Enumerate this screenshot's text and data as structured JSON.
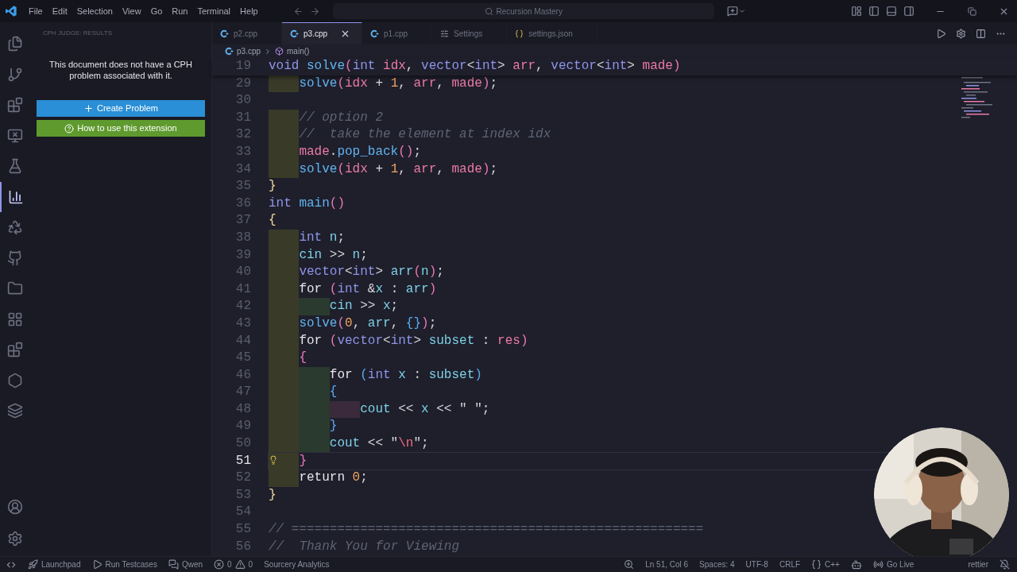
{
  "title_bar": {
    "menu": [
      "File",
      "Edit",
      "Selection",
      "View",
      "Go",
      "Run",
      "Terminal",
      "Help"
    ],
    "search": "Recursion Mastery"
  },
  "sidebar": {
    "title": "CPH JUDGE: RESULTS",
    "message": "This document does not have a CPH problem associated with it.",
    "buttons": [
      {
        "label": "Create Problem",
        "kind": "create"
      },
      {
        "label": "How to use this extension",
        "kind": "help"
      }
    ]
  },
  "tabs": [
    {
      "label": "p2.cpp",
      "kind": "cpp",
      "selected": false
    },
    {
      "label": "p3.cpp",
      "kind": "cpp",
      "selected": true
    },
    {
      "label": "p1.cpp",
      "kind": "cpp",
      "selected": false
    },
    {
      "label": "Settings",
      "kind": "settings",
      "selected": false
    },
    {
      "label": "settings.json",
      "kind": "json",
      "selected": false
    }
  ],
  "breadcrumb": [
    "p3.cpp",
    "main()"
  ],
  "editor": {
    "sticky": {
      "number": "19",
      "tokens": [
        {
          "kind": "kw",
          "text": "void "
        },
        {
          "kind": "fn",
          "text": "solve"
        },
        {
          "kind": "b1",
          "text": "("
        },
        {
          "kind": "kw",
          "text": "int "
        },
        {
          "kind": "param",
          "text": "idx"
        },
        {
          "kind": "p",
          "text": ", "
        },
        {
          "kind": "kw",
          "text": "vector"
        },
        {
          "kind": "p",
          "text": "<"
        },
        {
          "kind": "kw",
          "text": "int"
        },
        {
          "kind": "p",
          "text": "> "
        },
        {
          "kind": "param",
          "text": "arr"
        },
        {
          "kind": "p",
          "text": ", "
        },
        {
          "kind": "kw",
          "text": "vector"
        },
        {
          "kind": "p",
          "text": "<"
        },
        {
          "kind": "kw",
          "text": "int"
        },
        {
          "kind": "p",
          "text": "> "
        },
        {
          "kind": "param",
          "text": "made"
        },
        {
          "kind": "b1",
          "text": ")"
        }
      ]
    },
    "lines": [
      {
        "number": "29",
        "current": false,
        "lightbulb": false,
        "indent_guides": [
          {
            "color": "#393a28"
          }
        ],
        "tokens": [
          {
            "kind": "fn",
            "text": "solve"
          },
          {
            "kind": "b1",
            "text": "("
          },
          {
            "kind": "param",
            "text": "idx"
          },
          {
            "kind": "p",
            "text": " + "
          },
          {
            "kind": "num",
            "text": "1"
          },
          {
            "kind": "p",
            "text": ", "
          },
          {
            "kind": "param",
            "text": "arr"
          },
          {
            "kind": "p",
            "text": ", "
          },
          {
            "kind": "param",
            "text": "made"
          },
          {
            "kind": "b1",
            "text": ")"
          },
          {
            "kind": "p",
            "text": ";"
          }
        ]
      },
      {
        "number": "30",
        "current": false,
        "lightbulb": false
      },
      {
        "number": "31",
        "current": false,
        "lightbulb": false,
        "indent_guides": [
          {
            "color": "#393a28"
          }
        ],
        "tokens": [
          {
            "kind": "cm",
            "text": "// option 2"
          }
        ]
      },
      {
        "number": "32",
        "current": false,
        "lightbulb": false,
        "indent_guides": [
          {
            "color": "#393a28"
          }
        ],
        "tokens": [
          {
            "kind": "cm",
            "text": "//  take the element at index idx"
          }
        ]
      },
      {
        "number": "33",
        "current": false,
        "lightbulb": false,
        "indent_guides": [
          {
            "color": "#393a28"
          }
        ],
        "tokens": [
          {
            "kind": "param",
            "text": "made"
          },
          {
            "kind": "p",
            "text": "."
          },
          {
            "kind": "fn",
            "text": "pop_back"
          },
          {
            "kind": "b1",
            "text": "()"
          },
          {
            "kind": "p",
            "text": ";"
          }
        ]
      },
      {
        "number": "34",
        "current": false,
        "lightbulb": false,
        "indent_guides": [
          {
            "color": "#393a28"
          }
        ],
        "tokens": [
          {
            "kind": "fn",
            "text": "solve"
          },
          {
            "kind": "b1",
            "text": "("
          },
          {
            "kind": "param",
            "text": "idx"
          },
          {
            "kind": "p",
            "text": " + "
          },
          {
            "kind": "num",
            "text": "1"
          },
          {
            "kind": "p",
            "text": ", "
          },
          {
            "kind": "param",
            "text": "arr"
          },
          {
            "kind": "p",
            "text": ", "
          },
          {
            "kind": "param",
            "text": "made"
          },
          {
            "kind": "b1",
            "text": ")"
          },
          {
            "kind": "p",
            "text": ";"
          }
        ]
      },
      {
        "number": "35",
        "current": false,
        "lightbulb": false,
        "tokens": [
          {
            "kind": "b0",
            "text": "}"
          }
        ]
      },
      {
        "number": "36",
        "current": false,
        "lightbulb": false,
        "tokens": [
          {
            "kind": "kw",
            "text": "int "
          },
          {
            "kind": "fn",
            "text": "main"
          },
          {
            "kind": "b1",
            "text": "()"
          }
        ]
      },
      {
        "number": "37",
        "current": false,
        "lightbulb": false,
        "tokens": [
          {
            "kind": "b0",
            "text": "{"
          }
        ]
      },
      {
        "number": "38",
        "current": false,
        "lightbulb": false,
        "indent_guides": [
          {
            "color": "#393a28"
          }
        ],
        "tokens": [
          {
            "kind": "kw",
            "text": "int "
          },
          {
            "kind": "var",
            "text": "n"
          },
          {
            "kind": "p",
            "text": ";"
          }
        ]
      },
      {
        "number": "39",
        "current": false,
        "lightbulb": false,
        "indent_guides": [
          {
            "color": "#393a28"
          }
        ],
        "tokens": [
          {
            "kind": "var",
            "text": "cin"
          },
          {
            "kind": "p",
            "text": " >> "
          },
          {
            "kind": "var",
            "text": "n"
          },
          {
            "kind": "p",
            "text": ";"
          }
        ]
      },
      {
        "number": "40",
        "current": false,
        "lightbulb": false,
        "indent_guides": [
          {
            "color": "#393a28"
          }
        ],
        "tokens": [
          {
            "kind": "kw",
            "text": "vector"
          },
          {
            "kind": "p",
            "text": "<"
          },
          {
            "kind": "kw",
            "text": "int"
          },
          {
            "kind": "p",
            "text": "> "
          },
          {
            "kind": "var",
            "text": "arr"
          },
          {
            "kind": "b1",
            "text": "("
          },
          {
            "kind": "var",
            "text": "n"
          },
          {
            "kind": "b1",
            "text": ")"
          },
          {
            "kind": "p",
            "text": ";"
          }
        ]
      },
      {
        "number": "41",
        "current": false,
        "lightbulb": false,
        "indent_guides": [
          {
            "color": "#393a28"
          }
        ],
        "tokens": [
          {
            "kind": "ctrl",
            "text": "for "
          },
          {
            "kind": "b1",
            "text": "("
          },
          {
            "kind": "kw",
            "text": "int "
          },
          {
            "kind": "p",
            "text": "&"
          },
          {
            "kind": "var",
            "text": "x"
          },
          {
            "kind": "p",
            "text": " : "
          },
          {
            "kind": "var",
            "text": "arr"
          },
          {
            "kind": "b1",
            "text": ")"
          }
        ]
      },
      {
        "number": "42",
        "current": false,
        "lightbulb": false,
        "indent_guides": [
          {
            "color": "#393a28"
          },
          {
            "color": "#2b3a2e"
          }
        ],
        "tokens": [
          {
            "kind": "var",
            "text": "cin"
          },
          {
            "kind": "p",
            "text": " >> "
          },
          {
            "kind": "var",
            "text": "x"
          },
          {
            "kind": "p",
            "text": ";"
          }
        ]
      },
      {
        "number": "43",
        "current": false,
        "lightbulb": false,
        "indent_guides": [
          {
            "color": "#393a28"
          }
        ],
        "tokens": [
          {
            "kind": "fn",
            "text": "solve"
          },
          {
            "kind": "b1",
            "text": "("
          },
          {
            "kind": "num",
            "text": "0"
          },
          {
            "kind": "p",
            "text": ", "
          },
          {
            "kind": "var",
            "text": "arr"
          },
          {
            "kind": "p",
            "text": ", "
          },
          {
            "kind": "b2",
            "text": "{}"
          },
          {
            "kind": "b1",
            "text": ")"
          },
          {
            "kind": "p",
            "text": ";"
          }
        ]
      },
      {
        "number": "44",
        "current": false,
        "lightbulb": false,
        "indent_guides": [
          {
            "color": "#393a28"
          }
        ],
        "tokens": [
          {
            "kind": "ctrl",
            "text": "for "
          },
          {
            "kind": "b1",
            "text": "("
          },
          {
            "kind": "kw",
            "text": "vector"
          },
          {
            "kind": "p",
            "text": "<"
          },
          {
            "kind": "kw",
            "text": "int"
          },
          {
            "kind": "p",
            "text": "> "
          },
          {
            "kind": "var",
            "text": "subset"
          },
          {
            "kind": "p",
            "text": " : "
          },
          {
            "kind": "param",
            "text": "res"
          },
          {
            "kind": "b1",
            "text": ")"
          }
        ]
      },
      {
        "number": "45",
        "current": false,
        "lightbulb": false,
        "indent_guides": [
          {
            "color": "#393a28"
          }
        ],
        "tokens": [
          {
            "kind": "b1",
            "text": "{"
          }
        ]
      },
      {
        "number": "46",
        "current": false,
        "lightbulb": false,
        "indent_guides": [
          {
            "color": "#393a28"
          },
          {
            "color": "#2b3a2e"
          }
        ],
        "tokens": [
          {
            "kind": "ctrl",
            "text": "for "
          },
          {
            "kind": "b2",
            "text": "("
          },
          {
            "kind": "kw",
            "text": "int "
          },
          {
            "kind": "var",
            "text": "x"
          },
          {
            "kind": "p",
            "text": " : "
          },
          {
            "kind": "var",
            "text": "subset"
          },
          {
            "kind": "b2",
            "text": ")"
          }
        ]
      },
      {
        "number": "47",
        "current": false,
        "lightbulb": false,
        "indent_guides": [
          {
            "color": "#393a28"
          },
          {
            "color": "#2b3a2e"
          }
        ],
        "tokens": [
          {
            "kind": "b2",
            "text": "{"
          }
        ]
      },
      {
        "number": "48",
        "current": false,
        "lightbulb": false,
        "indent_guides": [
          {
            "color": "#393a28"
          },
          {
            "color": "#2b3a2e"
          },
          {
            "color": "#3a2a3b"
          }
        ],
        "tokens": [
          {
            "kind": "var",
            "text": "cout"
          },
          {
            "kind": "p",
            "text": " << "
          },
          {
            "kind": "var",
            "text": "x"
          },
          {
            "kind": "p",
            "text": " << "
          },
          {
            "kind": "str",
            "text": "\" \""
          },
          {
            "kind": "p",
            "text": ";"
          }
        ]
      },
      {
        "number": "49",
        "current": false,
        "lightbulb": false,
        "indent_guides": [
          {
            "color": "#393a28"
          },
          {
            "color": "#2b3a2e"
          }
        ],
        "tokens": [
          {
            "kind": "b2",
            "text": "}"
          }
        ]
      },
      {
        "number": "50",
        "current": false,
        "lightbulb": false,
        "indent_guides": [
          {
            "color": "#393a28"
          },
          {
            "color": "#2b3a2e"
          }
        ],
        "tokens": [
          {
            "kind": "var",
            "text": "cout"
          },
          {
            "kind": "p",
            "text": " << "
          },
          {
            "kind": "str",
            "text": "\""
          },
          {
            "kind": "esc",
            "text": "\\n"
          },
          {
            "kind": "str",
            "text": "\""
          },
          {
            "kind": "p",
            "text": ";"
          }
        ]
      },
      {
        "number": "51",
        "current": true,
        "lightbulb": true,
        "indent_guides": [
          {
            "color": "#393a28"
          }
        ],
        "tokens": [
          {
            "kind": "b1",
            "text": "}"
          }
        ]
      },
      {
        "number": "52",
        "current": false,
        "lightbulb": false,
        "indent_guides": [
          {
            "color": "#393a28"
          }
        ],
        "tokens": [
          {
            "kind": "ctrl",
            "text": "return "
          },
          {
            "kind": "num",
            "text": "0"
          },
          {
            "kind": "p",
            "text": ";"
          }
        ]
      },
      {
        "number": "53",
        "current": false,
        "lightbulb": false,
        "tokens": [
          {
            "kind": "b0",
            "text": "}"
          }
        ]
      },
      {
        "number": "54",
        "current": false,
        "lightbulb": false
      },
      {
        "number": "55",
        "current": false,
        "lightbulb": false,
        "tokens": [
          {
            "kind": "cm",
            "text": "// ======================================================"
          }
        ]
      },
      {
        "number": "56",
        "current": false,
        "lightbulb": false,
        "tokens": [
          {
            "kind": "cm",
            "text": "//  Thank You for Viewing"
          }
        ]
      }
    ]
  },
  "status_bar": {
    "left": [
      {
        "kind": "remote"
      },
      {
        "kind": "launchpad",
        "label": "Launchpad"
      },
      {
        "kind": "play",
        "label": "Run Testcases"
      },
      {
        "kind": "chat",
        "label": "Qwen"
      },
      {
        "kind": "problems",
        "errors": "0",
        "warnings": "0"
      },
      {
        "kind": "text",
        "label": "Sourcery Analytics"
      }
    ],
    "right": [
      {
        "kind": "zoom"
      },
      {
        "kind": "text",
        "label": "Ln 51, Col 6"
      },
      {
        "kind": "text",
        "label": "Spaces: 4"
      },
      {
        "kind": "text",
        "label": "UTF-8"
      },
      {
        "kind": "text",
        "label": "CRLF"
      },
      {
        "kind": "lang",
        "label": "C++"
      },
      {
        "kind": "copilot"
      },
      {
        "kind": "live",
        "label": "Go Live"
      },
      {
        "kind": "text",
        "label": "rettier"
      },
      {
        "kind": "bell"
      }
    ]
  }
}
